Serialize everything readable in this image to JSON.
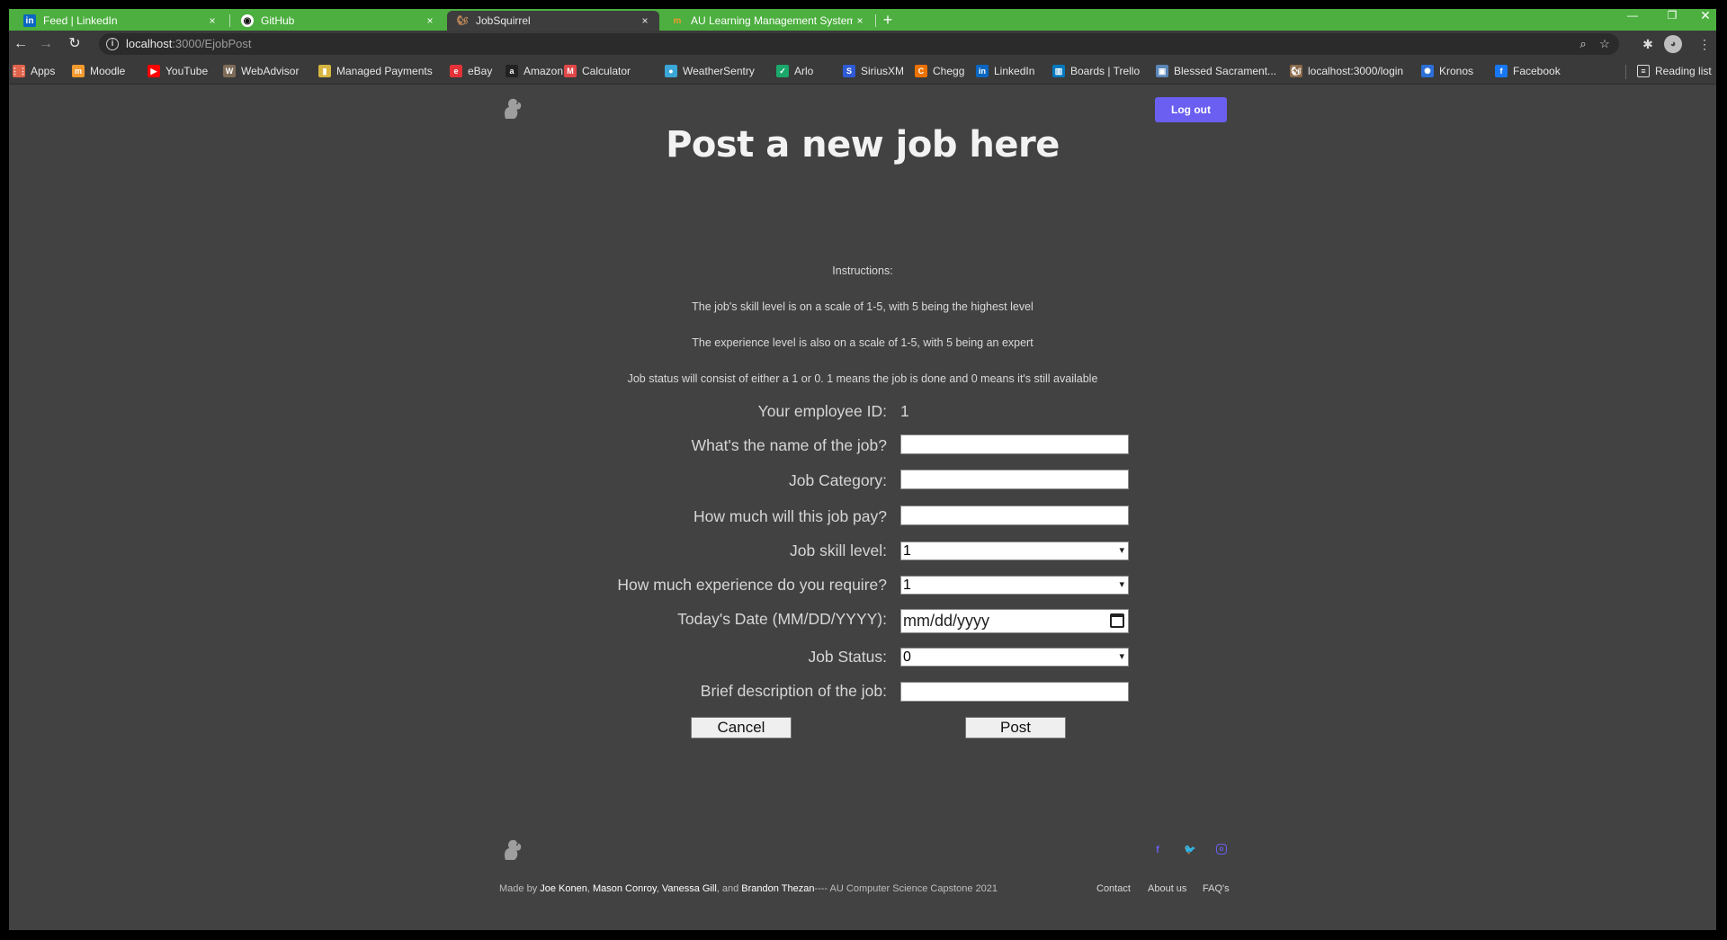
{
  "browser": {
    "tabs": [
      {
        "title": "Feed | LinkedIn",
        "icon": "linkedin-icon",
        "close": "×"
      },
      {
        "title": "GitHub",
        "icon": "github-icon",
        "close": "×"
      },
      {
        "title": "JobSquirrel",
        "icon": "squirrel-icon",
        "close": "×"
      },
      {
        "title": "AU Learning Management System",
        "icon": "moodle-icon",
        "close": "×"
      }
    ],
    "new_tab": "+",
    "url_host": "localhost",
    "url_path": ":3000/EjobPost",
    "bookmarks": [
      {
        "label": "Apps",
        "icon": "apps-grid-icon",
        "color": "#e0644c"
      },
      {
        "label": "Moodle",
        "icon": "moodle-icon",
        "color": "#f29a2e"
      },
      {
        "label": "YouTube",
        "icon": "youtube-icon",
        "color": "#ff0000"
      },
      {
        "label": "WebAdvisor",
        "icon": "webadvisor-icon",
        "color": "#7d6b57"
      },
      {
        "label": "Managed Payments",
        "icon": "payments-icon",
        "color": "#d6b640"
      },
      {
        "label": "eBay",
        "icon": "ebay-icon",
        "color": "#e53238"
      },
      {
        "label": "Amazon",
        "icon": "amazon-icon",
        "color": "#222222"
      },
      {
        "label": "Calculator",
        "icon": "calculator-icon",
        "color": "#e04848"
      },
      {
        "label": "WeatherSentry",
        "icon": "weather-icon",
        "color": "#3aa7d8"
      },
      {
        "label": "Arlo",
        "icon": "arlo-icon",
        "color": "#1aa86b"
      },
      {
        "label": "SiriusXM",
        "icon": "siriusxm-icon",
        "color": "#2f5bd6"
      },
      {
        "label": "Chegg",
        "icon": "chegg-icon",
        "color": "#eb7100"
      },
      {
        "label": "LinkedIn",
        "icon": "linkedin-icon",
        "color": "#0a66c2"
      },
      {
        "label": "Boards | Trello",
        "icon": "trello-icon",
        "color": "#0079bf"
      },
      {
        "label": "Blessed Sacrament...",
        "icon": "church-icon",
        "color": "#5a86b8"
      },
      {
        "label": "localhost:3000/login",
        "icon": "squirrel-icon",
        "color": "#8a6a4a"
      },
      {
        "label": "Kronos",
        "icon": "kronos-icon",
        "color": "#2c6fd6"
      },
      {
        "label": "Facebook",
        "icon": "facebook-icon",
        "color": "#1877f2"
      }
    ],
    "reading_list": "Reading list",
    "accent": "#4caf3f"
  },
  "header": {
    "logout_label": "Log out",
    "title": "Post a new job here"
  },
  "instructions": [
    "Instructions:",
    "The job's skill level is on a scale of 1-5, with 5 being the highest level",
    "The experience level is also on a scale of 1-5, with 5 being an expert",
    "Job status will consist of either a 1 or 0. 1 means the job is done and 0 means it's still available"
  ],
  "form": {
    "employee_id_label": "Your employee ID:",
    "employee_id_value": "1",
    "job_name_label": "What's the name of the job?",
    "job_name_value": "",
    "category_label": "Job Category:",
    "category_value": "",
    "pay_label": "How much will this job pay?",
    "pay_value": "",
    "skill_label": "Job skill level:",
    "skill_value": "1",
    "experience_label": "How much experience do you require?",
    "experience_value": "1",
    "date_label": "Today's Date (MM/DD/YYYY):",
    "date_placeholder": "mm/dd/yyyy",
    "status_label": "Job Status:",
    "status_value": "0",
    "description_label": "Brief description of the job:",
    "description_value": "",
    "cancel_label": "Cancel",
    "post_label": "Post"
  },
  "footer": {
    "made_by": "Made by ",
    "names": [
      "Joe Konen",
      "Mason Conroy",
      "Vanessa Gill",
      "Brandon Thezan"
    ],
    "sep1": ", ",
    "sep2": ", ",
    "sep3": ", and ",
    "suffix": "---- AU Computer Science Capstone 2021",
    "links": [
      "Contact",
      "About us",
      "FAQ's"
    ],
    "accent": "#6a5ff0"
  }
}
